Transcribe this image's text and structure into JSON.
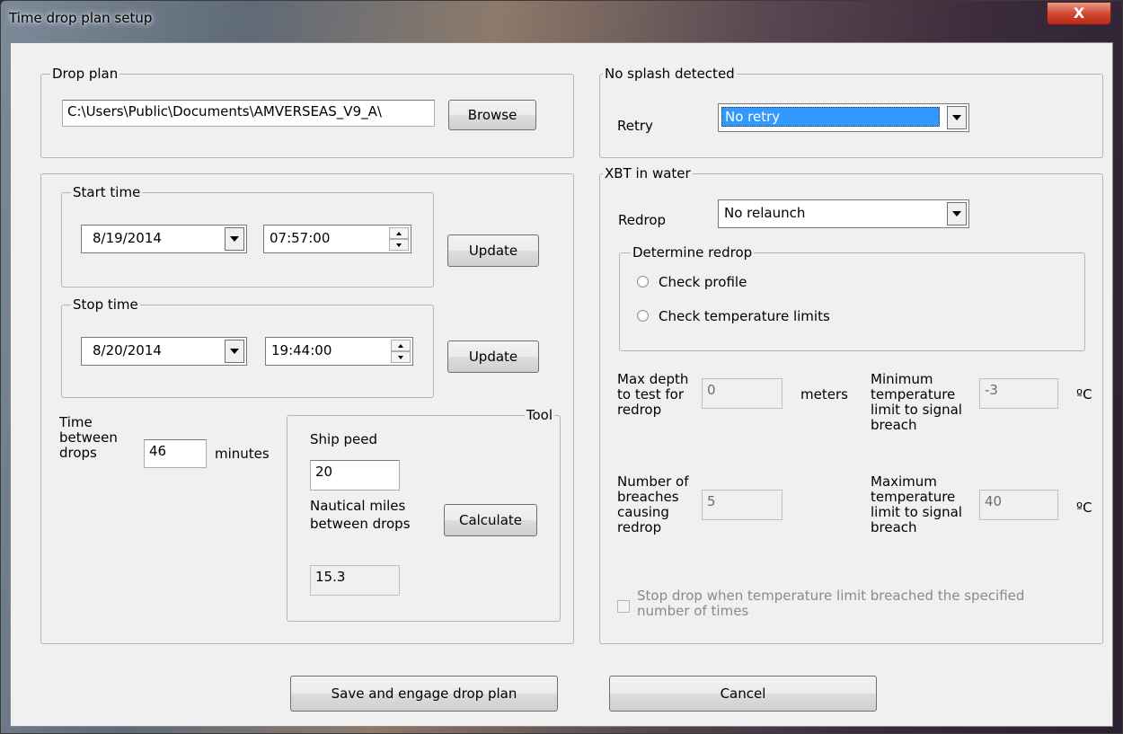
{
  "window": {
    "title": "Time drop plan setup",
    "close_glyph": "X"
  },
  "drop_plan": {
    "legend": "Drop plan",
    "path": "C:\\Users\\Public\\Documents\\AMVERSEAS_V9_A\\",
    "browse_label": "Browse"
  },
  "start_time": {
    "legend": "Start time",
    "date": "8/19/2014",
    "time": "07:57:00",
    "update_label": "Update"
  },
  "stop_time": {
    "legend": "Stop time",
    "date": "8/20/2014",
    "time": "19:44:00",
    "update_label": "Update"
  },
  "interval": {
    "label_line1": "Time",
    "label_line2": "between",
    "label_line3": "drops",
    "value": "46",
    "unit": "minutes"
  },
  "tool": {
    "legend": "Tool",
    "ship_speed_label": "Ship peed",
    "ship_speed_value": "20",
    "nm_label_line1": "Nautical miles",
    "nm_label_line2": "between drops",
    "calculate_label": "Calculate",
    "result_value": "15.3"
  },
  "no_splash": {
    "legend": "No splash detected",
    "retry_label": "Retry",
    "retry_value": "No retry"
  },
  "xbt": {
    "legend": "XBT in water",
    "redrop_label": "Redrop",
    "redrop_value": "No relaunch",
    "determine": {
      "legend": "Determine redrop",
      "check_profile": "Check profile",
      "check_temp": "Check temperature limits"
    },
    "max_depth": {
      "line1": "Max depth",
      "line2": "to test for",
      "line3": "redrop",
      "value": "0",
      "unit": "meters"
    },
    "min_temp": {
      "line1": "Minimum",
      "line2": "temperature",
      "line3": "limit to signal",
      "line4": "breach",
      "value": "-3",
      "unit": "ºC"
    },
    "breaches": {
      "line1": "Number of",
      "line2": "breaches",
      "line3": "causing",
      "line4": "redrop",
      "value": "5"
    },
    "max_temp": {
      "line1": "Maximum",
      "line2": "temperature",
      "line3": "limit to signal",
      "line4": "breach",
      "value": "40",
      "unit": "ºC"
    },
    "stop_drop_line1": "Stop drop when temperature limit breached the specified",
    "stop_drop_line2": "number of times"
  },
  "footer": {
    "save_label": "Save and engage drop plan",
    "cancel_label": "Cancel"
  },
  "colors": {
    "selection": "#3399ff",
    "dialog_bg": "#f0f0f0",
    "close_red": "#c7412b"
  }
}
